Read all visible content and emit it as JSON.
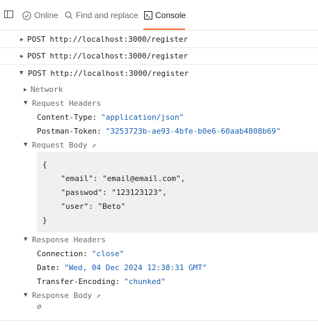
{
  "tabs": [
    {
      "label": "Online",
      "icon": "check-circle-icon"
    },
    {
      "label": "Find and replace",
      "icon": "search-icon"
    },
    {
      "label": "Console",
      "icon": "console-icon"
    }
  ],
  "requests": [
    {
      "method": "POST",
      "url": "http://localhost:3000/register",
      "expanded": false
    },
    {
      "method": "POST",
      "url": "http://localhost:3000/register",
      "expanded": false
    },
    {
      "method": "POST",
      "url": "http://localhost:3000/register",
      "expanded": true
    }
  ],
  "details": {
    "network": "Network",
    "request_headers": "Request Headers",
    "req_headers": [
      {
        "key": "Content-Type:",
        "value": "\"application/json\""
      },
      {
        "key": "Postman-Token:",
        "value": "\"3253723b-ae93-4bfe-b0e6-60aab4808b69\""
      }
    ],
    "request_body": "Request Body",
    "body_lines": [
      "{",
      "    \"email\": \"email@email.com\",",
      "    \"passwod\": \"123123123\",",
      "    \"user\": \"Beto\"",
      "}"
    ],
    "response_headers": "Response Headers",
    "res_headers": [
      {
        "key": "Connection:",
        "value": "\"close\""
      },
      {
        "key": "Date:",
        "value": "\"Wed, 04 Dec 2024 12:38:31 GMT\""
      },
      {
        "key": "Transfer-Encoding:",
        "value": "\"chunked\""
      }
    ],
    "response_body": "Response Body",
    "response_body_value": "∅"
  },
  "colors": {
    "accent": "#ff6c37",
    "value": "#1a5fb4"
  }
}
